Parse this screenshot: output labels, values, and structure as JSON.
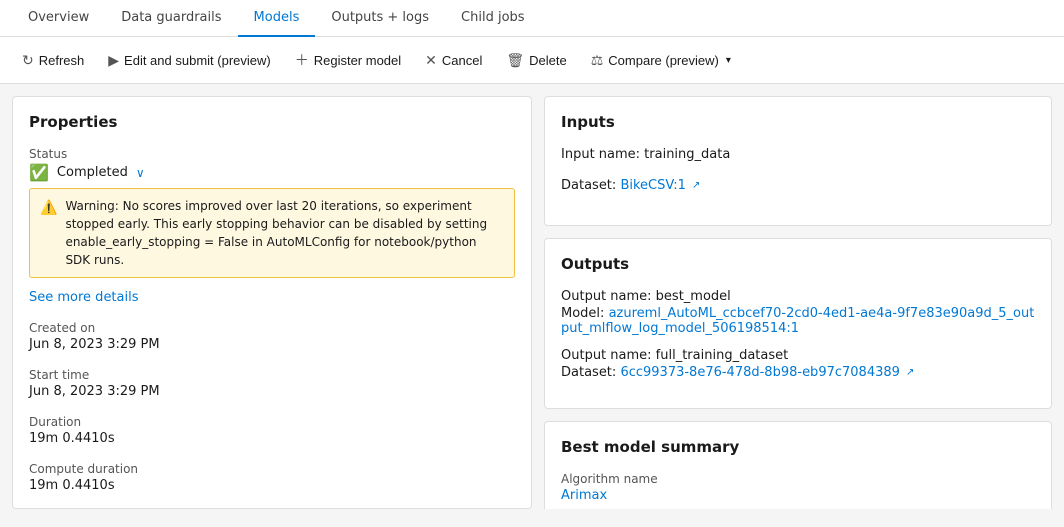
{
  "tabs": [
    {
      "label": "Overview",
      "active": false
    },
    {
      "label": "Data guardrails",
      "active": false
    },
    {
      "label": "Models",
      "active": true
    },
    {
      "label": "Outputs + logs",
      "active": false
    },
    {
      "label": "Child jobs",
      "active": false
    }
  ],
  "toolbar": {
    "refresh": "Refresh",
    "edit_submit": "Edit and submit (preview)",
    "register_model": "Register model",
    "cancel": "Cancel",
    "delete": "Delete",
    "compare": "Compare (preview)"
  },
  "properties": {
    "title": "Properties",
    "status_label": "Status",
    "status_value": "Completed",
    "warning_text": "Warning: No scores improved over last 20 iterations, so experiment stopped early. This early stopping behavior can be disabled by setting enable_early_stopping = False in AutoMLConfig for notebook/python SDK runs.",
    "see_more": "See more details",
    "created_on_label": "Created on",
    "created_on_value": "Jun 8, 2023 3:29 PM",
    "start_time_label": "Start time",
    "start_time_value": "Jun 8, 2023 3:29 PM",
    "duration_label": "Duration",
    "duration_value": "19m 0.4410s",
    "compute_duration_label": "Compute duration",
    "compute_duration_value": "19m 0.4410s"
  },
  "inputs": {
    "title": "Inputs",
    "input_name_label": "Input name: training_data",
    "dataset_label": "Dataset:",
    "dataset_link": "BikeCSV:1"
  },
  "outputs": {
    "title": "Outputs",
    "output1_name": "Output name: best_model",
    "output1_model_label": "Model:",
    "output1_model_link": "azureml_AutoML_ccbcef70-2cd0-4ed1-ae4a-9f7e83e90a9d_5_output_mlflow_log_model_506198514:1",
    "output2_name": "Output name: full_training_dataset",
    "output2_dataset_label": "Dataset:",
    "output2_dataset_link": "6cc99373-8e76-478d-8b98-eb97c7084389"
  },
  "best_model_summary": {
    "title": "Best model summary",
    "algorithm_name_label": "Algorithm name",
    "algorithm_name_link": "Arimax"
  }
}
